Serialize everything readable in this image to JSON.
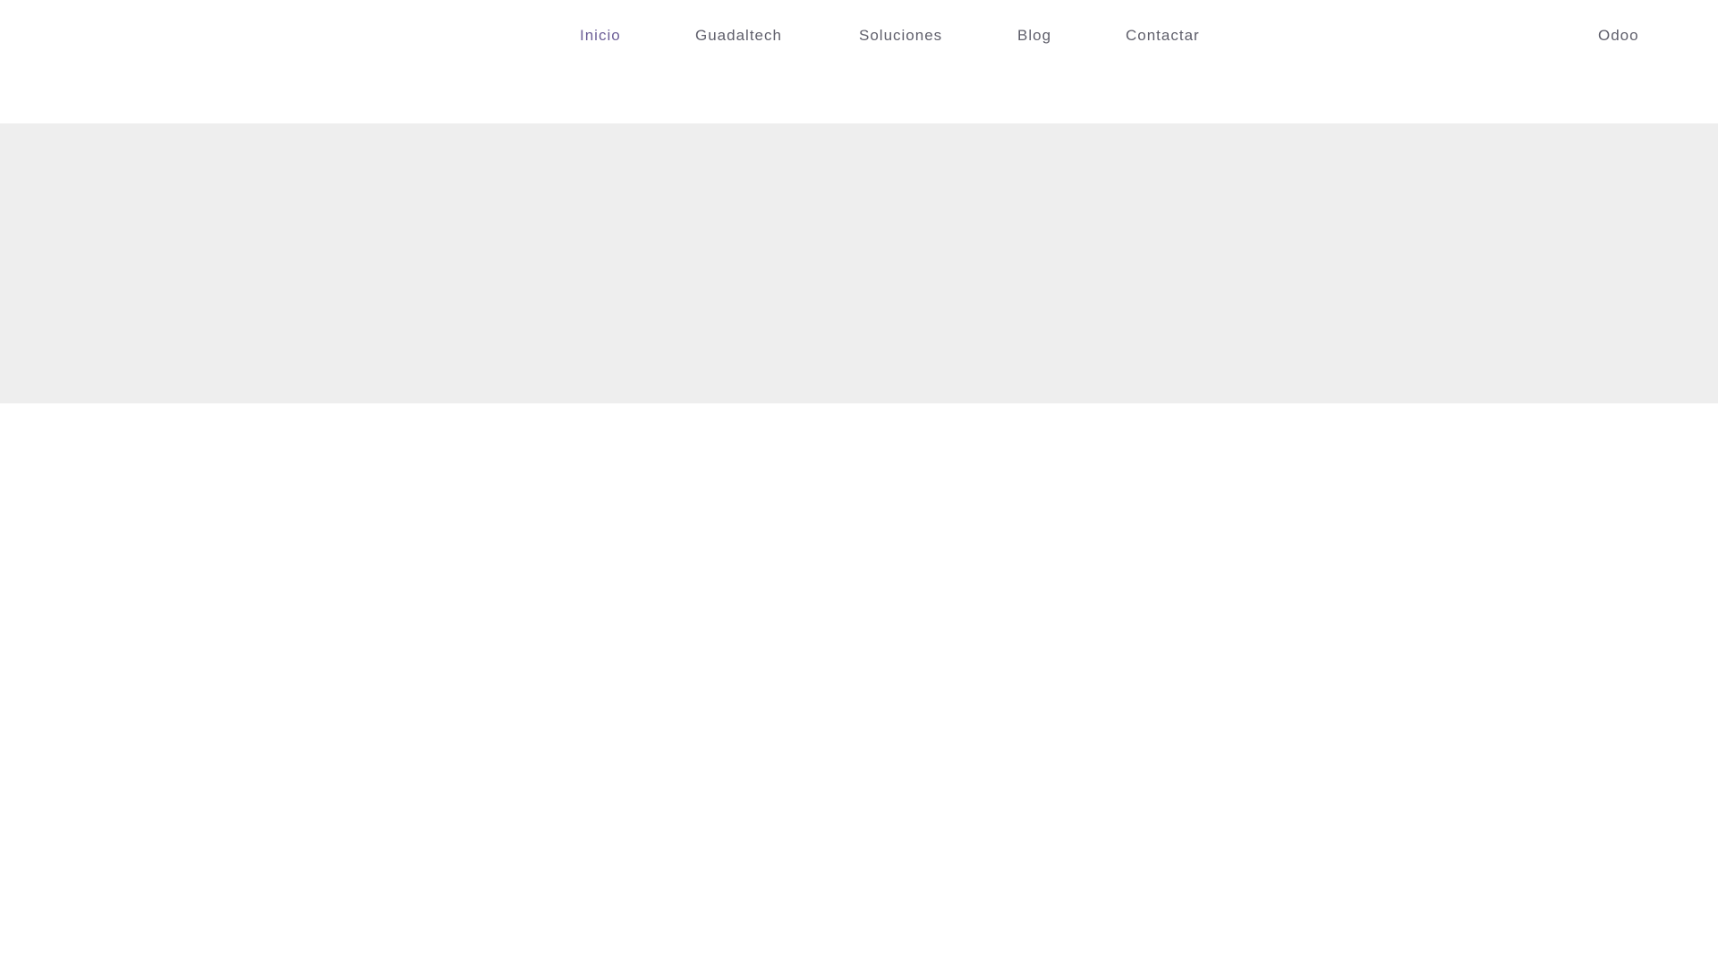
{
  "nav": {
    "items": [
      {
        "label": "Inicio",
        "active": true
      },
      {
        "label": "Guadaltech",
        "active": false
      },
      {
        "label": "Soluciones",
        "active": false
      },
      {
        "label": "Blog",
        "active": false
      },
      {
        "label": "Contactar",
        "active": false
      }
    ],
    "right_item": {
      "label": "Odoo"
    }
  },
  "colors": {
    "active_link": "#6d5f97",
    "link": "#5f5f6b",
    "hero_band": "#eeeeee",
    "background": "#ffffff"
  }
}
